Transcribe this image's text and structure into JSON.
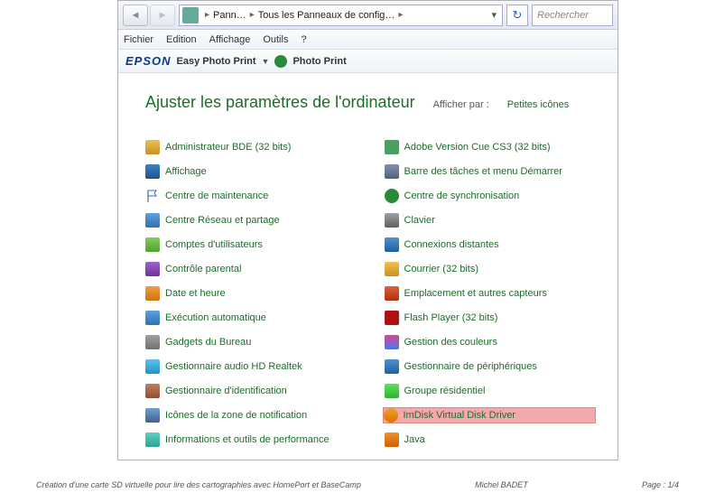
{
  "addr": {
    "crumb1": "Pann…",
    "crumb2": "Tous les Panneaux de config…",
    "search_placeholder": "Rechercher"
  },
  "menu": {
    "m1": "Fichier",
    "m2": "Edition",
    "m3": "Affichage",
    "m4": "Outils",
    "m5": "?"
  },
  "epson": {
    "logo": "EPSON",
    "easy": "Easy Photo Print",
    "pp": "Photo Print"
  },
  "head": {
    "title": "Ajuster les paramètres de l'ordinateur",
    "aff_label": "Afficher par :",
    "aff_value": "Petites icônes "
  },
  "col1": [
    {
      "label": "Administrateur BDE (32 bits)",
      "ic": "i-bde"
    },
    {
      "label": "Affichage",
      "ic": "i-aff"
    },
    {
      "label": "Centre de maintenance",
      "ic": "i-flag"
    },
    {
      "label": "Centre Réseau et partage",
      "ic": "i-net"
    },
    {
      "label": "Comptes d'utilisateurs",
      "ic": "i-users"
    },
    {
      "label": "Contrôle parental",
      "ic": "i-par"
    },
    {
      "label": "Date et heure",
      "ic": "i-date"
    },
    {
      "label": "Exécution automatique",
      "ic": "i-exec"
    },
    {
      "label": "Gadgets du Bureau",
      "ic": "i-gad"
    },
    {
      "label": "Gestionnaire audio HD Realtek",
      "ic": "i-snd"
    },
    {
      "label": "Gestionnaire d'identification",
      "ic": "i-id"
    },
    {
      "label": "Icônes de la zone de notification",
      "ic": "i-tray"
    },
    {
      "label": "Informations et outils de performance",
      "ic": "i-perf"
    }
  ],
  "col2": [
    {
      "label": "Adobe Version Cue CS3 (32 bits)",
      "ic": "i-adobe"
    },
    {
      "label": "Barre des tâches et menu Démarrer",
      "ic": "i-task"
    },
    {
      "label": "Centre de synchronisation",
      "ic": "i-sync"
    },
    {
      "label": "Clavier",
      "ic": "i-kb"
    },
    {
      "label": "Connexions distantes",
      "ic": "i-rdp"
    },
    {
      "label": "Courrier (32 bits)",
      "ic": "i-mail"
    },
    {
      "label": "Emplacement et autres capteurs",
      "ic": "i-loc"
    },
    {
      "label": "Flash Player (32 bits)",
      "ic": "i-flash"
    },
    {
      "label": "Gestion des couleurs",
      "ic": "i-color"
    },
    {
      "label": "Gestionnaire de périphériques",
      "ic": "i-dev"
    },
    {
      "label": "Groupe résidentiel",
      "ic": "i-home"
    },
    {
      "label": "ImDisk Virtual Disk Driver",
      "ic": "i-imdisk",
      "hl": true
    },
    {
      "label": "Java",
      "ic": "i-java"
    }
  ],
  "footer": {
    "left": "Création d'une carte SD virtuelle pour lire des cartographies avec HomePort et BaseCamp",
    "mid": "Michel BADET",
    "right": "Page : 1/4"
  }
}
